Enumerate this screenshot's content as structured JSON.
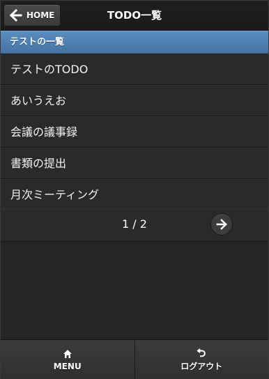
{
  "header": {
    "title": "TODO一覧",
    "home_button": {
      "label": "HOME",
      "icon": "arrow-left-icon"
    }
  },
  "section": {
    "title": "テストの一覧",
    "color": "#4f80b3"
  },
  "todos": [
    {
      "label": "テストのTODO"
    },
    {
      "label": "あいうえお"
    },
    {
      "label": "会議の議事録"
    },
    {
      "label": "書類の提出"
    },
    {
      "label": "月次ミーティング"
    }
  ],
  "pager": {
    "indicator": "1 / 2",
    "next_icon": "arrow-right-icon"
  },
  "footer": {
    "menu": {
      "label": "MENU",
      "icon": "home-icon"
    },
    "logout": {
      "label": "ログアウト",
      "icon": "undo-icon"
    }
  }
}
